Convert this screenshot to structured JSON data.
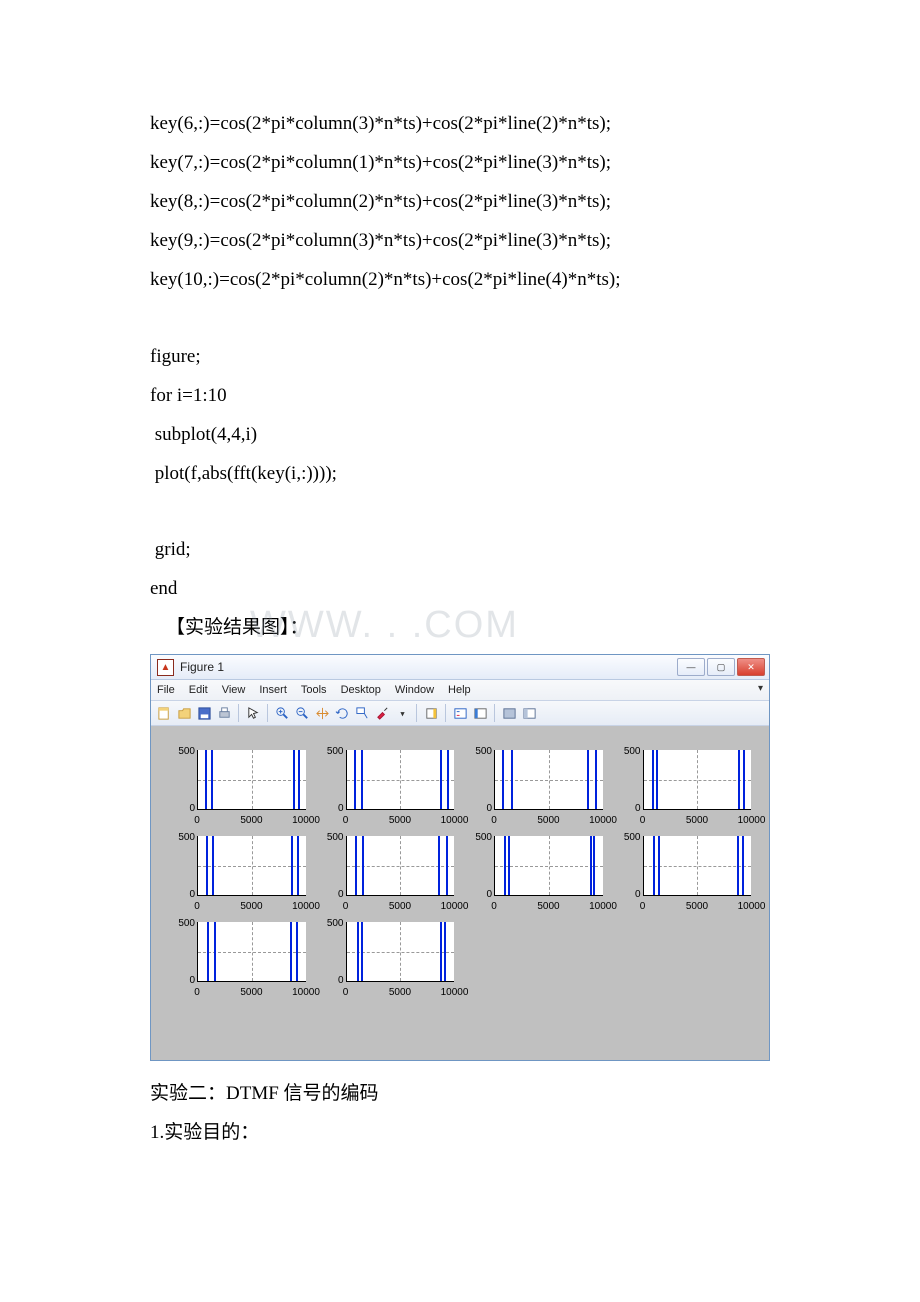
{
  "code": {
    "lines": [
      "key(6,:)=cos(2*pi*column(3)*n*ts)+cos(2*pi*line(2)*n*ts);",
      "key(7,:)=cos(2*pi*column(1)*n*ts)+cos(2*pi*line(3)*n*ts);",
      "key(8,:)=cos(2*pi*column(2)*n*ts)+cos(2*pi*line(3)*n*ts);",
      "key(9,:)=cos(2*pi*column(3)*n*ts)+cos(2*pi*line(3)*n*ts);",
      "key(10,:)=cos(2*pi*column(2)*n*ts)+cos(2*pi*line(4)*n*ts);",
      "",
      "figure;",
      "for i=1:10",
      " subplot(4,4,i)",
      " plot(f,abs(fft(key(i,:))));",
      "",
      " grid;",
      "end"
    ],
    "result_label": "【实验结果图】："
  },
  "window": {
    "title": "Figure 1",
    "menus": [
      "File",
      "Edit",
      "View",
      "Insert",
      "Tools",
      "Desktop",
      "Window",
      "Help"
    ]
  },
  "chart_data": [
    {
      "type": "line",
      "peaks_x": [
        697,
        1209
      ],
      "sym_peaks_x": [
        8791,
        9303
      ],
      "ylim": [
        0,
        500
      ],
      "xlim": [
        0,
        10000
      ],
      "xticks": [
        0,
        5000,
        10000
      ],
      "yticks": [
        0,
        500
      ]
    },
    {
      "type": "line",
      "peaks_x": [
        697,
        1336
      ],
      "sym_peaks_x": [
        8664,
        9303
      ],
      "ylim": [
        0,
        500
      ],
      "xlim": [
        0,
        10000
      ],
      "xticks": [
        0,
        5000,
        10000
      ],
      "yticks": [
        0,
        500
      ]
    },
    {
      "type": "line",
      "peaks_x": [
        697,
        1477
      ],
      "sym_peaks_x": [
        8523,
        9303
      ],
      "ylim": [
        0,
        500
      ],
      "xlim": [
        0,
        10000
      ],
      "xticks": [
        0,
        5000,
        10000
      ],
      "yticks": [
        0,
        500
      ]
    },
    {
      "type": "line",
      "peaks_x": [
        770,
        1209
      ],
      "sym_peaks_x": [
        8791,
        9230
      ],
      "ylim": [
        0,
        500
      ],
      "xlim": [
        0,
        10000
      ],
      "xticks": [
        0,
        5000,
        10000
      ],
      "yticks": [
        0,
        500
      ]
    },
    {
      "type": "line",
      "peaks_x": [
        770,
        1336
      ],
      "sym_peaks_x": [
        8664,
        9230
      ],
      "ylim": [
        0,
        500
      ],
      "xlim": [
        0,
        10000
      ],
      "xticks": [
        0,
        5000,
        10000
      ],
      "yticks": [
        0,
        500
      ]
    },
    {
      "type": "line",
      "peaks_x": [
        770,
        1477
      ],
      "sym_peaks_x": [
        8523,
        9230
      ],
      "ylim": [
        0,
        500
      ],
      "xlim": [
        0,
        10000
      ],
      "xticks": [
        0,
        5000,
        10000
      ],
      "yticks": [
        0,
        500
      ]
    },
    {
      "type": "line",
      "peaks_x": [
        852,
        1209
      ],
      "sym_peaks_x": [
        8791,
        9148
      ],
      "ylim": [
        0,
        500
      ],
      "xlim": [
        0,
        10000
      ],
      "xticks": [
        0,
        5000,
        10000
      ],
      "yticks": [
        0,
        500
      ]
    },
    {
      "type": "line",
      "peaks_x": [
        852,
        1336
      ],
      "sym_peaks_x": [
        8664,
        9148
      ],
      "ylim": [
        0,
        500
      ],
      "xlim": [
        0,
        10000
      ],
      "xticks": [
        0,
        5000,
        10000
      ],
      "yticks": [
        0,
        500
      ]
    },
    {
      "type": "line",
      "peaks_x": [
        852,
        1477
      ],
      "sym_peaks_x": [
        8523,
        9148
      ],
      "ylim": [
        0,
        500
      ],
      "xlim": [
        0,
        10000
      ],
      "xticks": [
        0,
        5000,
        10000
      ],
      "yticks": [
        0,
        500
      ]
    },
    {
      "type": "line",
      "peaks_x": [
        941,
        1336
      ],
      "sym_peaks_x": [
        8664,
        9059
      ],
      "ylim": [
        0,
        500
      ],
      "xlim": [
        0,
        10000
      ],
      "xticks": [
        0,
        5000,
        10000
      ],
      "yticks": [
        0,
        500
      ]
    }
  ],
  "after": {
    "line1": "实验二：DTMF 信号的编码",
    "line2": "1.实验目的："
  },
  "watermark": "WWW. . .COM"
}
